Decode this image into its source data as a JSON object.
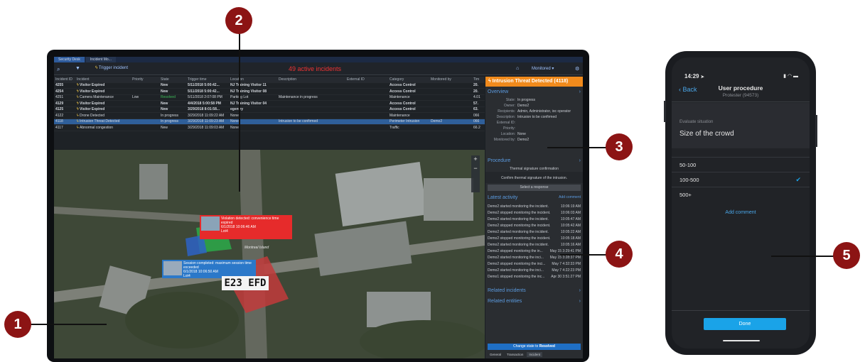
{
  "callouts": [
    "1",
    "2",
    "3",
    "4",
    "5"
  ],
  "desktop": {
    "tabs": [
      "Security Desk",
      "Incident Mo..."
    ],
    "trigger_incident": "Trigger incident",
    "active_incidents": "49 active incidents",
    "monitored": "Monitored",
    "columns": [
      "Incident ID",
      "Incident",
      "Priority",
      "State",
      "Trigger time",
      "Location",
      "Description",
      "External ID",
      "Category",
      "Monitored by",
      "Tim"
    ],
    "rows": [
      {
        "id": "4255",
        "incident": "Visitor Expired",
        "priority": "",
        "state": "New",
        "time": "5/11/2018 5:00:42...",
        "location": "NJ Training Visitor 11",
        "description": "",
        "ext": "",
        "category": "Access Control",
        "monitored": "",
        "tim": "20.",
        "bold": true
      },
      {
        "id": "4254",
        "incident": "Visitor Expired",
        "priority": "",
        "state": "New",
        "time": "5/11/2018 5:00:42...",
        "location": "NJ Training Visitor 08",
        "description": "",
        "ext": "",
        "category": "Access Control",
        "monitored": "",
        "tim": "20.",
        "bold": true
      },
      {
        "id": "4251",
        "incident": "Camera Maintenance",
        "priority": "Low",
        "state": "Resolved",
        "time": "5/11/2018 2:07:08 PM",
        "location": "Parking Lot",
        "description": "Maintenance in progress",
        "ext": "",
        "category": "Maintenance",
        "monitored": "",
        "tim": "4.01",
        "bold": false
      },
      {
        "id": "4129",
        "incident": "Visitor Expired",
        "priority": "",
        "state": "New",
        "time": "4/4/2018 5:00:58 PM",
        "location": "NJ Training Visitor 04",
        "description": "",
        "ext": "",
        "category": "Access Control",
        "monitored": "",
        "tim": "57.",
        "bold": true
      },
      {
        "id": "4125",
        "incident": "Visitor Expired",
        "priority": "",
        "state": "New",
        "time": "3/29/2018 8:01:58...",
        "location": "egentry",
        "description": "",
        "ext": "",
        "category": "Access Control",
        "monitored": "",
        "tim": "63.",
        "bold": true
      },
      {
        "id": "4122",
        "incident": "Drone Detected",
        "priority": "",
        "state": "In progress",
        "time": "3/29/2018 11:09:22 AM",
        "location": "None",
        "description": "",
        "ext": "",
        "category": "Maintenance",
        "monitored": "",
        "tim": "066",
        "bold": false
      },
      {
        "id": "4118",
        "incident": "Intrusion Threat Detected",
        "priority": "",
        "state": "In progress",
        "time": "3/29/2018 11:09:23 AM",
        "location": "None",
        "description": "Intrusion to be confirmed",
        "ext": "",
        "category": "Perimeter Intrusion",
        "monitored": "Demo2",
        "tim": "066",
        "bold": false
      },
      {
        "id": "4117",
        "incident": "Abnormal congestion",
        "priority": "",
        "state": "New",
        "time": "3/29/2018 11:09:03 AM",
        "location": "None",
        "description": "",
        "ext": "",
        "category": "Traffic",
        "monitored": "",
        "tim": "66.2",
        "bold": false
      }
    ],
    "map": {
      "alert_red": "Violation detected: convenience time expired",
      "alert_red_time": "6/1/2018 10:06:46 AM",
      "alert_red_sub": "Lot4",
      "alert_blue": "Session completed: maximum session time exceeded",
      "alert_blue_time": "6/1/2018 10:06:50 AM",
      "alert_blue_sub": "Lot4",
      "plate": "E23 EFD",
      "label_island": "Montreal Island"
    },
    "panel": {
      "title": "Intrusion Threat Detected (4118)",
      "overview": "Overview",
      "fields": [
        {
          "k": "State:",
          "v": "In progress"
        },
        {
          "k": "Owner:",
          "v": "Demo2"
        },
        {
          "k": "Recipients:",
          "v": "Admin, Administrator, ioc operator"
        },
        {
          "k": "Description:",
          "v": "Intrusion to be confirmed"
        },
        {
          "k": "External ID:",
          "v": ""
        },
        {
          "k": "Priority:",
          "v": ""
        },
        {
          "k": "Location:",
          "v": "None"
        },
        {
          "k": "Monitored by:",
          "v": "Demo2"
        }
      ],
      "procedure": "Procedure",
      "procedure_step": "Thermal signature confirmation",
      "procedure_text": "Confirm thermal signature of the intrusion.",
      "select_response": "Select a response",
      "latest_activity": "Latest activity",
      "add_comment": "Add comment",
      "activity": [
        {
          "t": "Demo2 started monitoring the incident.",
          "d": "10:06:19 AM"
        },
        {
          "t": "Demo2 stopped monitoring the incident.",
          "d": "10:06:03 AM"
        },
        {
          "t": "Demo2 started monitoring the incident.",
          "d": "10:05:47 AM"
        },
        {
          "t": "Demo2 stopped monitoring the incident.",
          "d": "10:05:42 AM"
        },
        {
          "t": "Demo2 started monitoring the incident.",
          "d": "10:05:22 AM"
        },
        {
          "t": "Demo2 stopped monitoring the incident.",
          "d": "10:05:18 AM"
        },
        {
          "t": "Demo2 started monitoring the incident.",
          "d": "10:05:16 AM"
        },
        {
          "t": "Demo2 stopped monitoring the in...",
          "d": "May 15 3:29:41 PM"
        },
        {
          "t": "Demo2 started monitoring the inci...",
          "d": "May 15 3:28:37 PM"
        },
        {
          "t": "Demo2 stopped monitoring the inci...",
          "d": "May 7 4:32:33 PM"
        },
        {
          "t": "Demo2 started monitoring the inci...",
          "d": "May 7 4:22:23 PM"
        },
        {
          "t": "Demo1 stopped monitoring the inc...",
          "d": "Apr 30 3:51:27 PM"
        }
      ],
      "related_incidents": "Related incidents",
      "related_entities": "Related entities",
      "change_state": "Change state to",
      "change_state_value": "Resolved",
      "bottom_tabs": [
        "General",
        "Transaction",
        "Incident"
      ]
    }
  },
  "phone": {
    "time": "14:29",
    "back": "Back",
    "title": "User procedure",
    "subtitle": "Protester (94573)",
    "section": "Evaluate situation",
    "question": "Size of the crowd",
    "options": [
      "50-100",
      "100-500",
      "500+"
    ],
    "selected_index": 1,
    "add_comment": "Add comment",
    "done": "Done"
  },
  "colors": {
    "callout": "#8c1414",
    "accent": "#f08a1c",
    "link": "#5b9be0",
    "phone_button": "#1aa3e8",
    "selected_row": "#2f5f9a"
  }
}
